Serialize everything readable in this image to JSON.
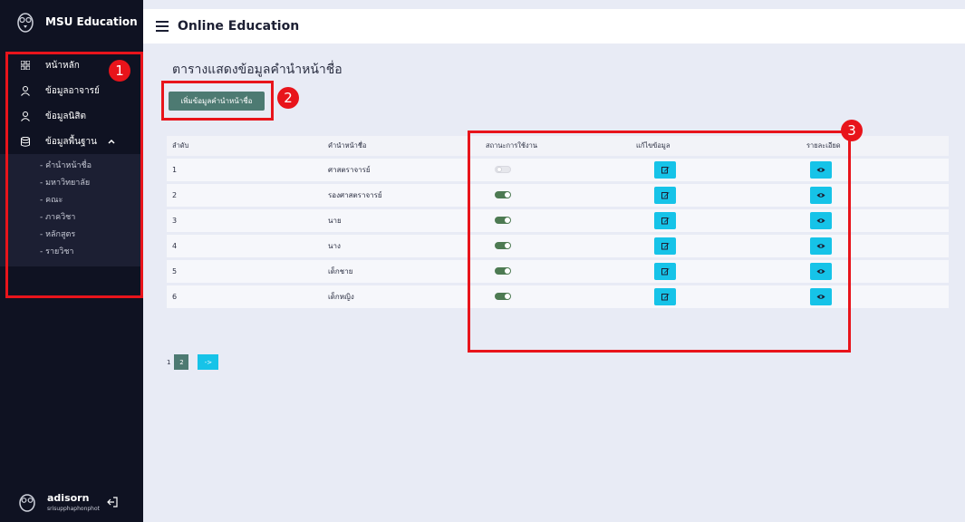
{
  "sidebar": {
    "brand": "MSU Education",
    "items": [
      {
        "label": "หน้าหลัก",
        "icon": "grid-icon"
      },
      {
        "label": "ข้อมูลอาจารย์",
        "icon": "user-icon"
      },
      {
        "label": "ข้อมูลนิสิต",
        "icon": "user-icon"
      },
      {
        "label": "ข้อมูลพื้นฐาน",
        "icon": "database-icon"
      }
    ],
    "subitems": [
      "- คำนำหน้าชื่อ",
      "- มหาวิทยาลัย",
      "- คณะ",
      "- ภาควิชา",
      "- หลักสูตร",
      "- รายวิชา"
    ],
    "user": {
      "name": "adisorn",
      "sub": "srisupphaphonphot"
    }
  },
  "topbar": {
    "title": "Online Education"
  },
  "main": {
    "page_title": "ตารางแสดงข้อมูลคำนำหน้าชื่อ",
    "add_button": "เพิ่มข้อมูลคำนำหน้าชื่อ",
    "table": {
      "headers": [
        "ลำดับ",
        "คำนำหน้าชื่อ",
        "สถานะการใช้งาน",
        "แก้ไขข้อมูล",
        "รายละเอียด"
      ],
      "rows": [
        {
          "no": "1",
          "prefix": "ศาสตราจารย์",
          "active": false
        },
        {
          "no": "2",
          "prefix": "รองศาสตราจารย์",
          "active": true
        },
        {
          "no": "3",
          "prefix": "นาย",
          "active": true
        },
        {
          "no": "4",
          "prefix": "นาง",
          "active": true
        },
        {
          "no": "5",
          "prefix": "เด็กชาย",
          "active": true
        },
        {
          "no": "6",
          "prefix": "เด็กหญิง",
          "active": true
        }
      ]
    },
    "pager": {
      "page1": "1",
      "page2": "2",
      "next": "->"
    }
  },
  "annotations": {
    "badge1": "1",
    "badge2": "2",
    "badge3": "3"
  },
  "colors": {
    "sidebar": "#0f1222",
    "accent": "#4d7a72",
    "info": "#16c3e8",
    "annotation": "#e8141b"
  }
}
